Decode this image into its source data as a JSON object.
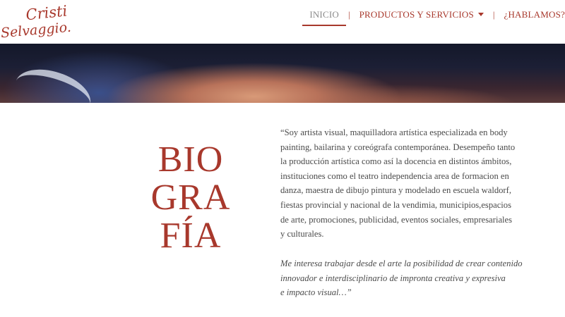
{
  "brand": {
    "logo_line1": "Cristi",
    "logo_line2": "Selvaggio."
  },
  "nav": {
    "items": [
      {
        "label": "INICIO",
        "active": true
      },
      {
        "label": "PRODUCTOS Y SERVICIOS",
        "has_dropdown": true
      },
      {
        "label": "¿HABLAMOS?"
      }
    ],
    "separator": "|"
  },
  "bio": {
    "title_lines": [
      "BIO",
      "GRA",
      "FÍA"
    ],
    "paragraph_lines": [
      "“Soy artista visual, maquilladora artística especializada en body",
      "painting, bailarina y coreógrafa contemporánea. Desempeño tanto",
      "la producción artística como así la docencia en distintos ámbitos,",
      "instituciones como el teatro independencia area de formacion en",
      "danza, maestra de dibujo pintura y modelado en escuela waldorf,",
      "fiestas provincial y nacional de la vendimia, municipios,espacios",
      "de arte, promociones, publicidad, eventos sociales, empresariales",
      "y culturales."
    ],
    "quote_lines": [
      "Me interesa trabajar desde el arte la posibilidad de crear contenido",
      "innovador e interdisciplinario de impronta creativa y expresiva",
      "e impacto visual…”"
    ]
  },
  "colors": {
    "accent": "#a8382c",
    "nav_active": "#8a8a8a",
    "body_text": "#4a4a4a"
  }
}
